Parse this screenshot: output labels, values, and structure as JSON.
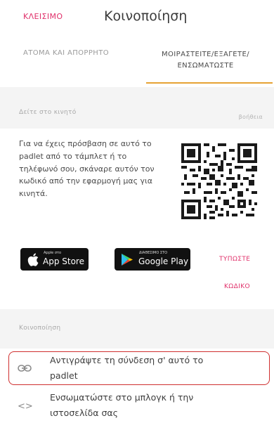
{
  "header": {
    "close_label": "ΚΛΕΙΣΙΜΟ",
    "title": "Κοινοποίηση"
  },
  "tabs": [
    {
      "label": "ΑΤΟΜΑ ΚΑΙ ΑΠΟΡΡΗΤΟ",
      "active": false
    },
    {
      "label_line1": "ΜΟΙΡΑΣΤΕΙΤΕ/ΕΞΑΓΕΤΕ/",
      "label_line2": "ΕΝΣΩΜΑΤΩΣΤΕ",
      "active": true
    }
  ],
  "mobile": {
    "section_label": "Δείτε στο κινητό",
    "help_label": "βοήθεια",
    "text": "Για να έχεις πρόσβαση σε αυτό το padlet από το τάμπλετ ή το τηλέφωνό σου, σκάναρε αυτόν τον κωδικό από την εφαρμογή μας για κινητά.",
    "app_store": {
      "sub": "Apple στο",
      "main": "App Store"
    },
    "google_play": {
      "sub": "ΔΙΑΘΕΣΙΜΟ ΣΤΟ",
      "main": "Google Play"
    },
    "print_line1": "ΤΥΠΩΣΤΕ",
    "print_line2": "ΚΩΔΙΚΟ"
  },
  "share": {
    "section_label": "Κοινοποίηση",
    "options": [
      {
        "icon": "link-icon",
        "line1": "Αντιγράψτε τη σύνδεση σ' αυτό το",
        "line2": "padlet"
      },
      {
        "icon": "code-icon",
        "line1": "Ενσωματώστε στο μπλογκ ή την",
        "line2": "ιστοσελίδα σας"
      }
    ]
  },
  "colors": {
    "accent": "#e0306a",
    "tab_underline": "#e6a233",
    "highlight": "#cf2f2f"
  }
}
